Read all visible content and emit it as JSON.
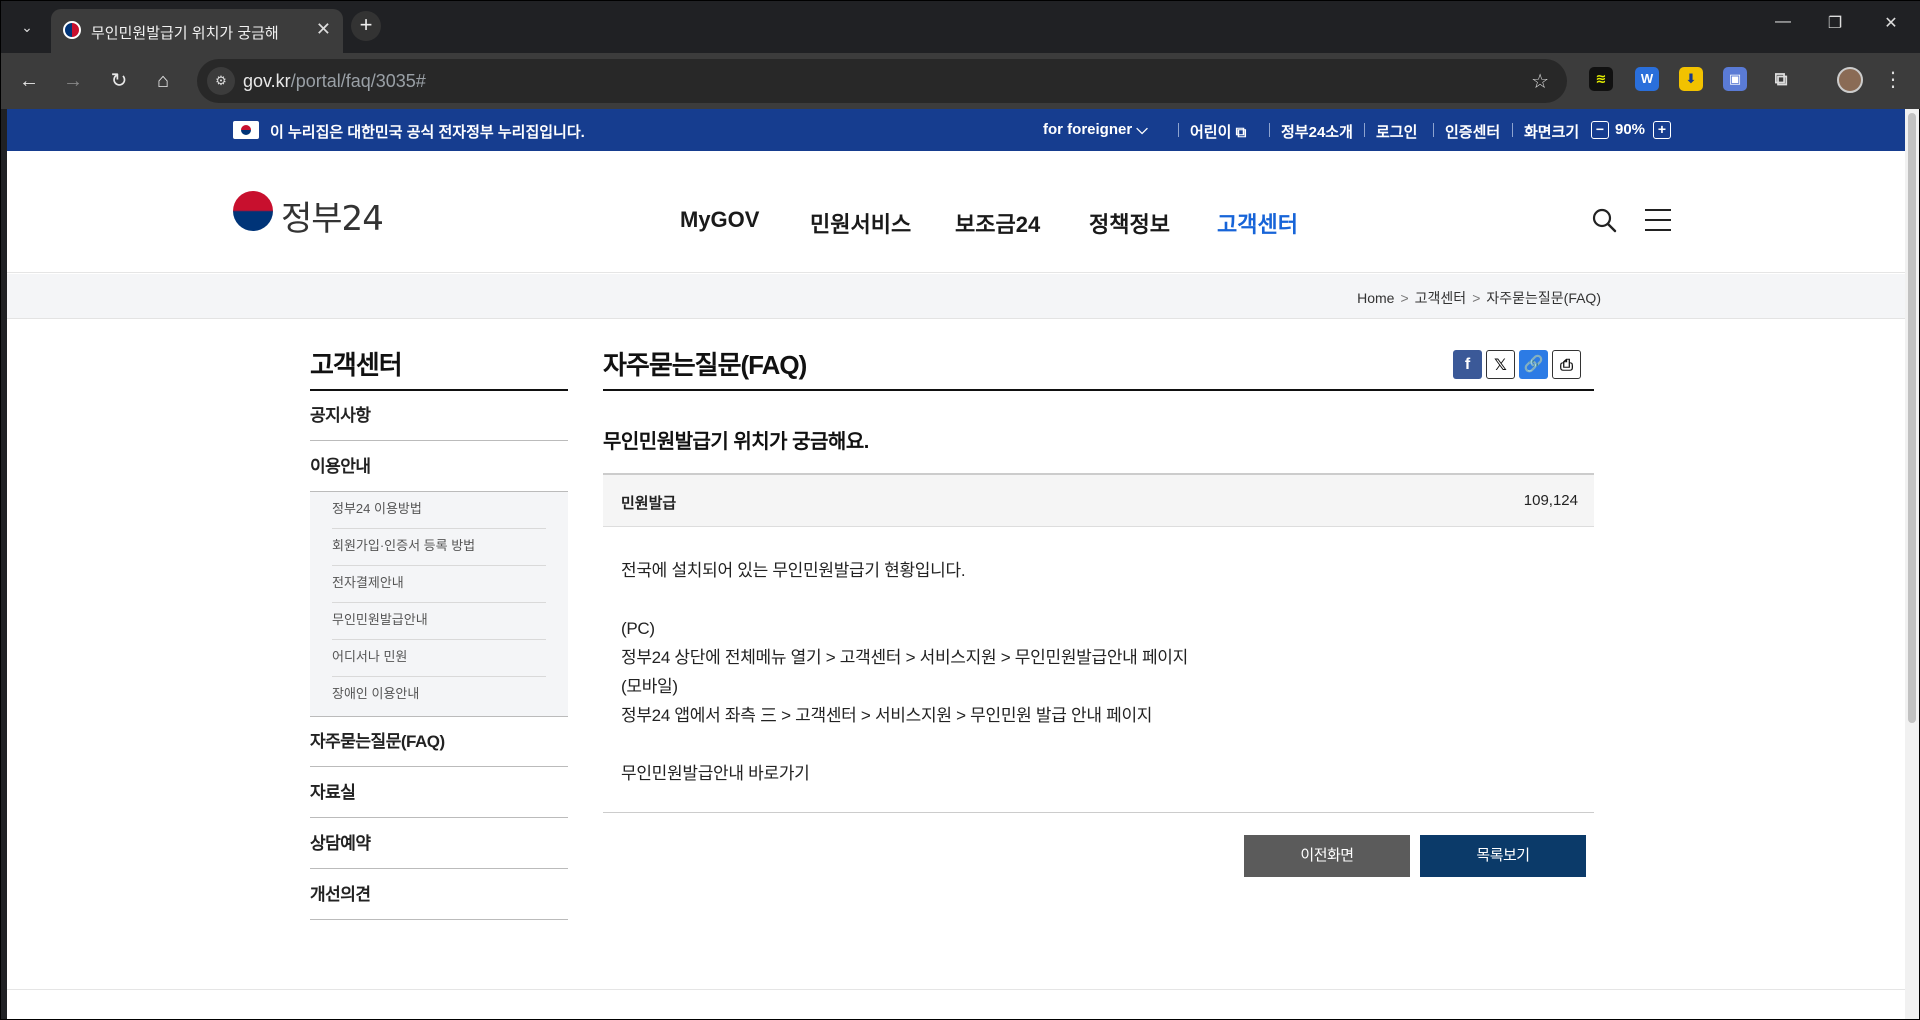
{
  "browser": {
    "tab_title": "무인민원발급기 위치가 궁금해",
    "url_host": "gov.kr",
    "url_path": "/portal/faq/3035#"
  },
  "banner": {
    "text": "이 누리집은 대한민국 공식 전자정부 누리집입니다.",
    "links": [
      "for foreigner",
      "어린이",
      "정부24소개",
      "로그인",
      "인증센터",
      "화면크기"
    ],
    "zoom_minus": "−",
    "zoom_value": "90%",
    "zoom_plus": "+"
  },
  "header": {
    "logo": "정부24",
    "nav": [
      "MyGOV",
      "민원서비스",
      "보조금24",
      "정책정보",
      "고객센터"
    ]
  },
  "breadcrumb": [
    "Home",
    "고객센터",
    "자주묻는질문(FAQ)"
  ],
  "lnb": {
    "title": "고객센터",
    "items": [
      "공지사항",
      "이용안내",
      "자주묻는질문(FAQ)",
      "자료실",
      "상담예약",
      "개선의견"
    ],
    "sub_items": [
      "정부24 이용방법",
      "회원가입·인증서 등록 방법",
      "전자결제안내",
      "무인민원발급안내",
      "어디서나 민원",
      "장애인 이용안내"
    ]
  },
  "content": {
    "title": "자주묻는질문(FAQ)",
    "question": "무인민원발급기 위치가 궁금해요.",
    "category": "민원발급",
    "views": "109,124",
    "answer_lines": [
      "전국에 설치되어 있는 무인민원발급기 현황입니다.",
      "",
      "(PC)",
      "정부24 상단에 전체메뉴 열기 > 고객센터 > 서비스지원 > 무인민원발급안내 페이지",
      "(모바일)",
      "정부24 앱에서 좌측 三 > 고객센터 > 서비스지원 > 무인민원 발급 안내 페이지",
      "",
      "무인민원발급안내 바로가기"
    ],
    "btn_prev": "이전화면",
    "btn_list": "목록보기"
  }
}
